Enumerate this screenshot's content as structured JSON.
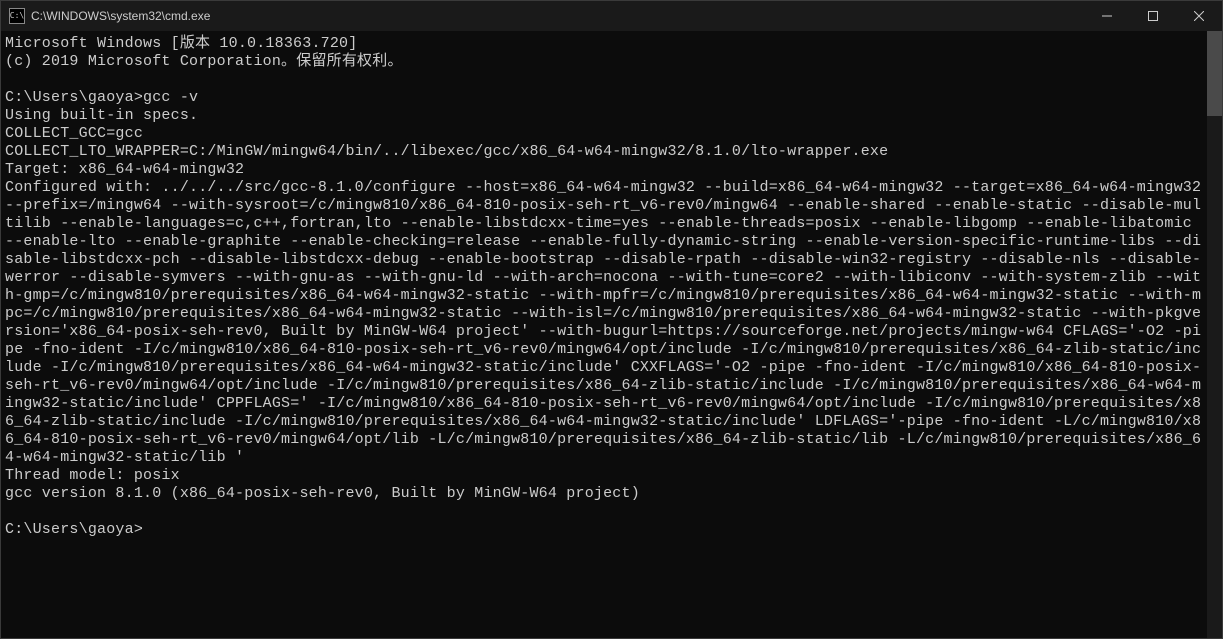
{
  "window": {
    "title": "C:\\WINDOWS\\system32\\cmd.exe",
    "icon_label": "C:\\"
  },
  "terminal": {
    "lines": [
      "Microsoft Windows [版本 10.0.18363.720]",
      "(c) 2019 Microsoft Corporation。保留所有权利。",
      "",
      "C:\\Users\\gaoya>gcc -v",
      "Using built-in specs.",
      "COLLECT_GCC=gcc",
      "COLLECT_LTO_WRAPPER=C:/MinGW/mingw64/bin/../libexec/gcc/x86_64-w64-mingw32/8.1.0/lto-wrapper.exe",
      "Target: x86_64-w64-mingw32",
      "Configured with: ../../../src/gcc-8.1.0/configure --host=x86_64-w64-mingw32 --build=x86_64-w64-mingw32 --target=x86_64-w64-mingw32 --prefix=/mingw64 --with-sysroot=/c/mingw810/x86_64-810-posix-seh-rt_v6-rev0/mingw64 --enable-shared --enable-static --disable-multilib --enable-languages=c,c++,fortran,lto --enable-libstdcxx-time=yes --enable-threads=posix --enable-libgomp --enable-libatomic --enable-lto --enable-graphite --enable-checking=release --enable-fully-dynamic-string --enable-version-specific-runtime-libs --disable-libstdcxx-pch --disable-libstdcxx-debug --enable-bootstrap --disable-rpath --disable-win32-registry --disable-nls --disable-werror --disable-symvers --with-gnu-as --with-gnu-ld --with-arch=nocona --with-tune=core2 --with-libiconv --with-system-zlib --with-gmp=/c/mingw810/prerequisites/x86_64-w64-mingw32-static --with-mpfr=/c/mingw810/prerequisites/x86_64-w64-mingw32-static --with-mpc=/c/mingw810/prerequisites/x86_64-w64-mingw32-static --with-isl=/c/mingw810/prerequisites/x86_64-w64-mingw32-static --with-pkgversion='x86_64-posix-seh-rev0, Built by MinGW-W64 project' --with-bugurl=https://sourceforge.net/projects/mingw-w64 CFLAGS='-O2 -pipe -fno-ident -I/c/mingw810/x86_64-810-posix-seh-rt_v6-rev0/mingw64/opt/include -I/c/mingw810/prerequisites/x86_64-zlib-static/include -I/c/mingw810/prerequisites/x86_64-w64-mingw32-static/include' CXXFLAGS='-O2 -pipe -fno-ident -I/c/mingw810/x86_64-810-posix-seh-rt_v6-rev0/mingw64/opt/include -I/c/mingw810/prerequisites/x86_64-zlib-static/include -I/c/mingw810/prerequisites/x86_64-w64-mingw32-static/include' CPPFLAGS=' -I/c/mingw810/x86_64-810-posix-seh-rt_v6-rev0/mingw64/opt/include -I/c/mingw810/prerequisites/x86_64-zlib-static/include -I/c/mingw810/prerequisites/x86_64-w64-mingw32-static/include' LDFLAGS='-pipe -fno-ident -L/c/mingw810/x86_64-810-posix-seh-rt_v6-rev0/mingw64/opt/lib -L/c/mingw810/prerequisites/x86_64-zlib-static/lib -L/c/mingw810/prerequisites/x86_64-w64-mingw32-static/lib '",
      "Thread model: posix",
      "gcc version 8.1.0 (x86_64-posix-seh-rev0, Built by MinGW-W64 project)",
      "",
      "C:\\Users\\gaoya>"
    ]
  }
}
